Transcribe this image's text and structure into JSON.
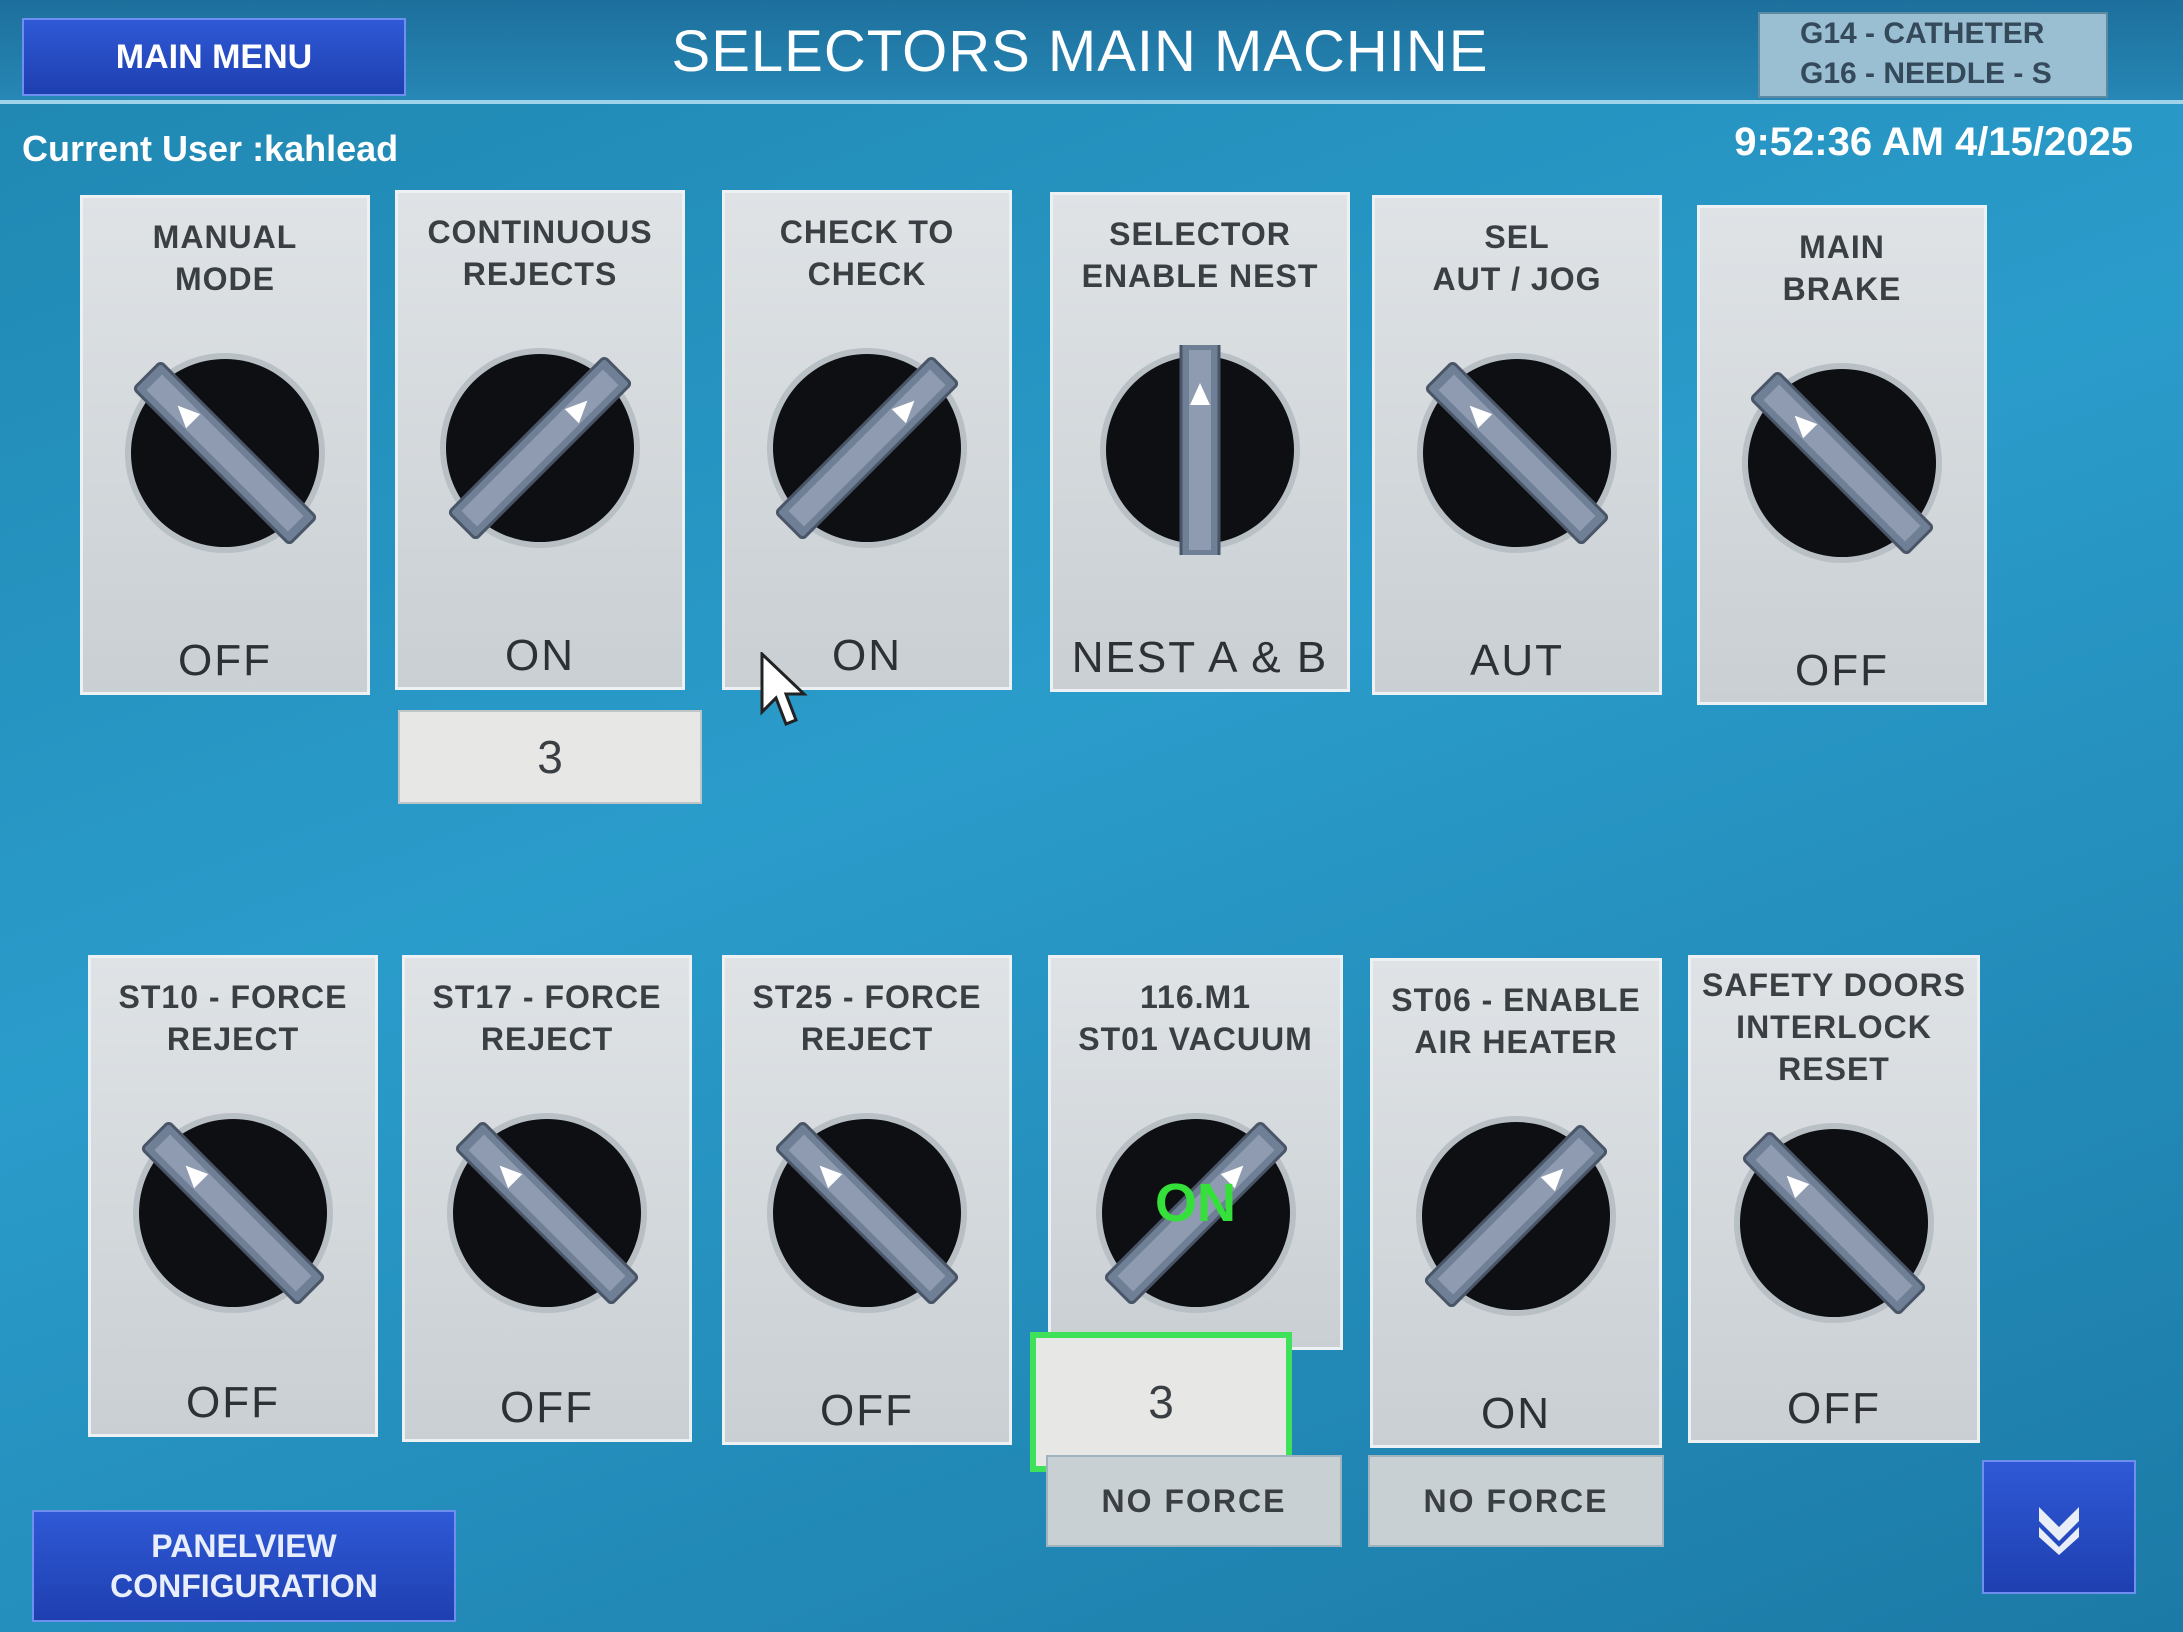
{
  "header": {
    "main_menu_label": "MAIN MENU",
    "title": "SELECTORS MAIN MACHINE",
    "product_line1": "G14 - CATHETER",
    "product_line2": "G16 - NEEDLE - S"
  },
  "status": {
    "current_user": "Current User :kahlead",
    "datetime": "9:52:36 AM 4/15/2025"
  },
  "top_selectors": [
    {
      "label_line1": "MANUAL",
      "label_line2": "MODE",
      "state": "OFF"
    },
    {
      "label_line1": "CONTINUOUS",
      "label_line2": "REJECTS",
      "state": "ON"
    },
    {
      "label_line1": "CHECK TO",
      "label_line2": "CHECK",
      "state": "ON"
    },
    {
      "label_line1": "SELECTOR",
      "label_line2": "ENABLE NEST",
      "state": "NEST A & B"
    },
    {
      "label_line1": "SEL",
      "label_line2": "AUT / JOG",
      "state": "AUT"
    },
    {
      "label_line1": "MAIN",
      "label_line2": "BRAKE",
      "state": "OFF"
    }
  ],
  "continuous_rejects_count": "3",
  "bottom_selectors": [
    {
      "label_line1": "ST10 - FORCE",
      "label_line2": "REJECT",
      "label_line3": "",
      "state": "OFF"
    },
    {
      "label_line1": "ST17 - FORCE",
      "label_line2": "REJECT",
      "label_line3": "",
      "state": "OFF"
    },
    {
      "label_line1": "ST25 - FORCE",
      "label_line2": "REJECT",
      "label_line3": "",
      "state": "OFF"
    },
    {
      "label_line1": "116.M1",
      "label_line2": "ST01 VACUUM",
      "label_line3": "",
      "state": "",
      "overlay": "ON"
    },
    {
      "label_line1": "ST06 - ENABLE",
      "label_line2": "AIR HEATER",
      "label_line3": "",
      "state": "ON"
    },
    {
      "label_line1": "SAFETY DOORS",
      "label_line2": "INTERLOCK",
      "label_line3": "RESET",
      "state": "OFF"
    }
  ],
  "vacuum_counter": "3",
  "force_labels": [
    "NO FORCE",
    "NO FORCE"
  ],
  "footer": {
    "panelview_line1": "PANELVIEW",
    "panelview_line2": "CONFIGURATION"
  },
  "icons": {
    "knob": "rotary-selector-icon",
    "nav": "next-page-arrow-icon",
    "cursor": "mouse-pointer-icon"
  },
  "colors": {
    "background": "#2a9ccb",
    "panel": "#d6dadd",
    "button": "#2547c2",
    "highlight": "#3fe05a"
  }
}
